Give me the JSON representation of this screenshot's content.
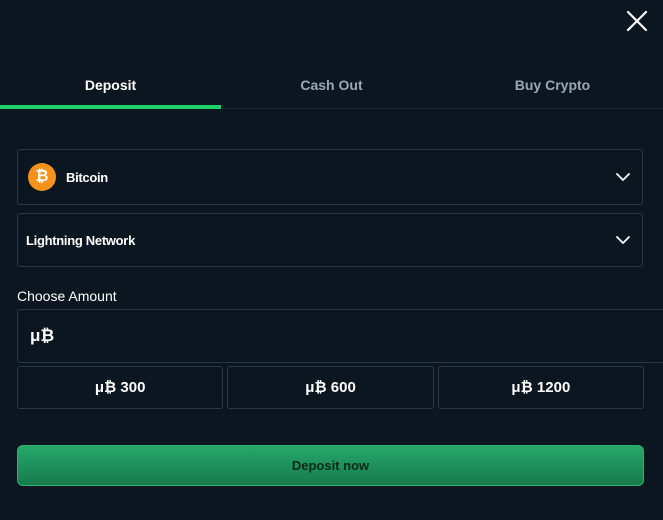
{
  "tabs": [
    {
      "label": "Deposit",
      "active": true
    },
    {
      "label": "Cash Out",
      "active": false
    },
    {
      "label": "Buy Crypto",
      "active": false
    }
  ],
  "currency_select": {
    "label": "Bitcoin",
    "icon": "bitcoin-icon",
    "icon_glyph": "₿",
    "icon_color": "#f7931a"
  },
  "network_select": {
    "label": "Lightning Network"
  },
  "amount": {
    "label": "Choose Amount",
    "value": "μ₿"
  },
  "presets": [
    {
      "label": "μ₿ 300"
    },
    {
      "label": "μ₿ 600"
    },
    {
      "label": "μ₿ 1200"
    }
  ],
  "deposit_button": {
    "label": "Deposit now"
  },
  "colors": {
    "background": "#0b1620",
    "accent": "#1fd26d",
    "button": "#1f9960",
    "border": "#2a3744"
  }
}
